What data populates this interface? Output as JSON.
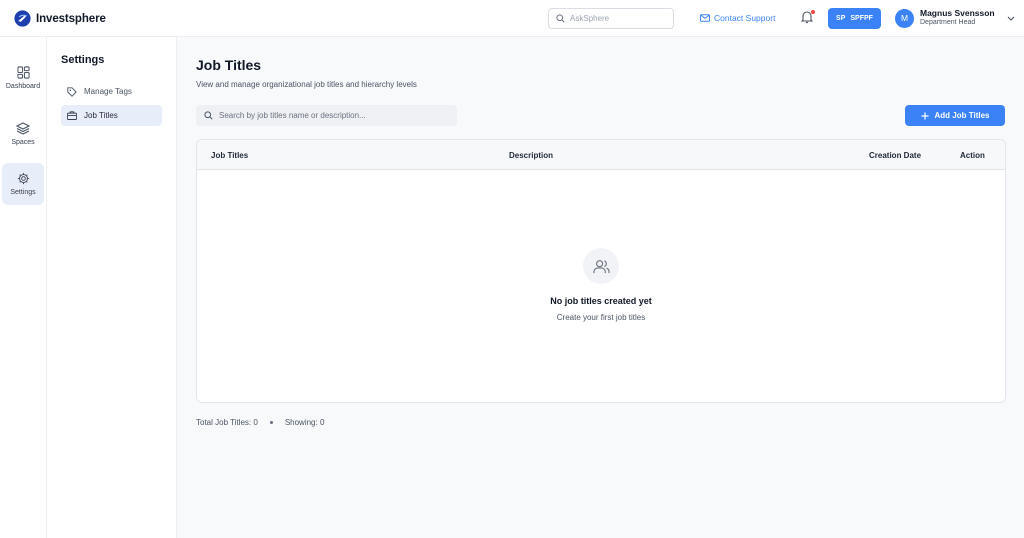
{
  "header": {
    "app_name": "Investsphere",
    "ask_placeholder": "AskSphere",
    "contact_support": "Contact Support",
    "space": {
      "code": "SP",
      "name": "SPFPF"
    },
    "user": {
      "initial": "M",
      "name": "Magnus Svensson",
      "role": "Department Head"
    }
  },
  "rail": {
    "items": [
      {
        "label": "Dashboard",
        "icon": "grid-icon"
      },
      {
        "label": "Spaces",
        "icon": "layers-icon"
      },
      {
        "label": "Settings",
        "icon": "gear-icon",
        "active": true
      }
    ]
  },
  "settings": {
    "title": "Settings",
    "items": [
      {
        "label": "Manage Tags",
        "icon": "tag-icon"
      },
      {
        "label": "Job Titles",
        "icon": "briefcase-icon",
        "active": true
      }
    ]
  },
  "main": {
    "title": "Job Titles",
    "subtitle": "View and manage organizational job titles and hierarchy levels",
    "search_placeholder": "Search by job titles name or description...",
    "add_button": "Add Job Titles",
    "table": {
      "columns": [
        "Job Titles",
        "Description",
        "Creation Date",
        "Action"
      ],
      "rows": []
    },
    "empty": {
      "title": "No job titles created yet",
      "subtitle": "Create your first job titles"
    },
    "footer": {
      "total": "Total Job Titles: 0",
      "showing": "Showing: 0"
    }
  },
  "colors": {
    "accent": "#3b82f6",
    "active_bg": "#e8eef9",
    "notification": "#ef4444"
  }
}
